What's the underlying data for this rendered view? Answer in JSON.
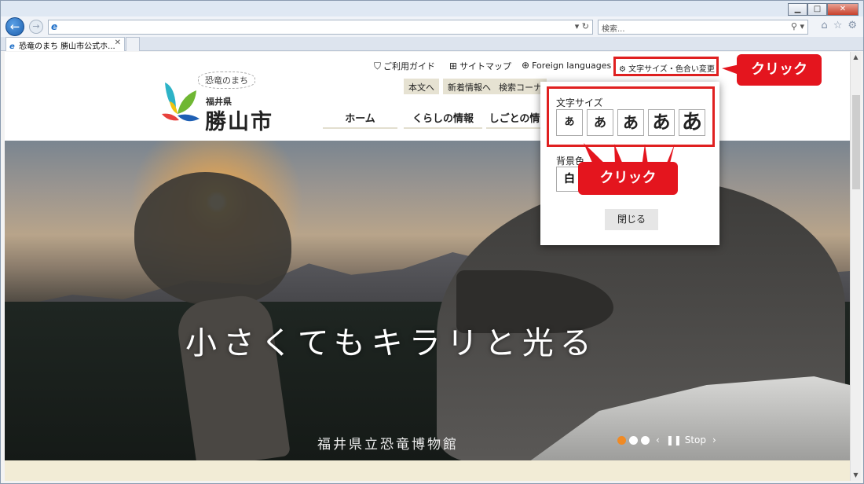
{
  "browser": {
    "window_buttons": [
      "▁",
      "□",
      "✕"
    ],
    "address_value": "",
    "address_controls": "▾ ↻",
    "search_placeholder": "検索...",
    "search_controls": "⚲ ▾",
    "tool_icons": [
      "⌂",
      "☆",
      "⚙"
    ],
    "tab_label": "恐竜のまち 勝山市公式ホ...",
    "tab_close": "✕",
    "ie_glyph": "e"
  },
  "site": {
    "logo_tagline": "恐竜のまち",
    "logo_prefecture": "福井県",
    "logo_city": "勝山市",
    "utility_links": [
      {
        "icon": "⛉",
        "label": "ご利用ガイド"
      },
      {
        "icon": "⊞",
        "label": "サイトマップ"
      },
      {
        "icon": "⊕",
        "label": "Foreign languages"
      }
    ],
    "font_color_button": {
      "icon": "⚙",
      "label": "文字サイズ・色合い変更"
    },
    "sub_buttons": [
      "本文へ",
      "新着情報へ",
      "検索コーナ"
    ],
    "global_nav": [
      "ホーム",
      "くらしの情報",
      "しごとの情"
    ]
  },
  "hero": {
    "slogan": "小さくてもキラリと光る",
    "caption": "福井県立恐竜博物館",
    "carousel_total": 3,
    "carousel_active": 1,
    "prev_label": "‹",
    "pause_label": "❚❚ Stop",
    "next_label": "›"
  },
  "popup": {
    "font_size_title": "文字サイズ",
    "font_size_options": [
      "あ",
      "あ",
      "あ",
      "あ",
      "あ"
    ],
    "bg_color_title": "背景色",
    "bg_color_options": [
      "白"
    ],
    "close_label": "閉じる"
  },
  "annotations": {
    "callout_top": "クリック",
    "callout_popup": "クリック",
    "color": "#e4151e"
  },
  "scrollbar": {
    "up": "▲",
    "down": "▼"
  }
}
